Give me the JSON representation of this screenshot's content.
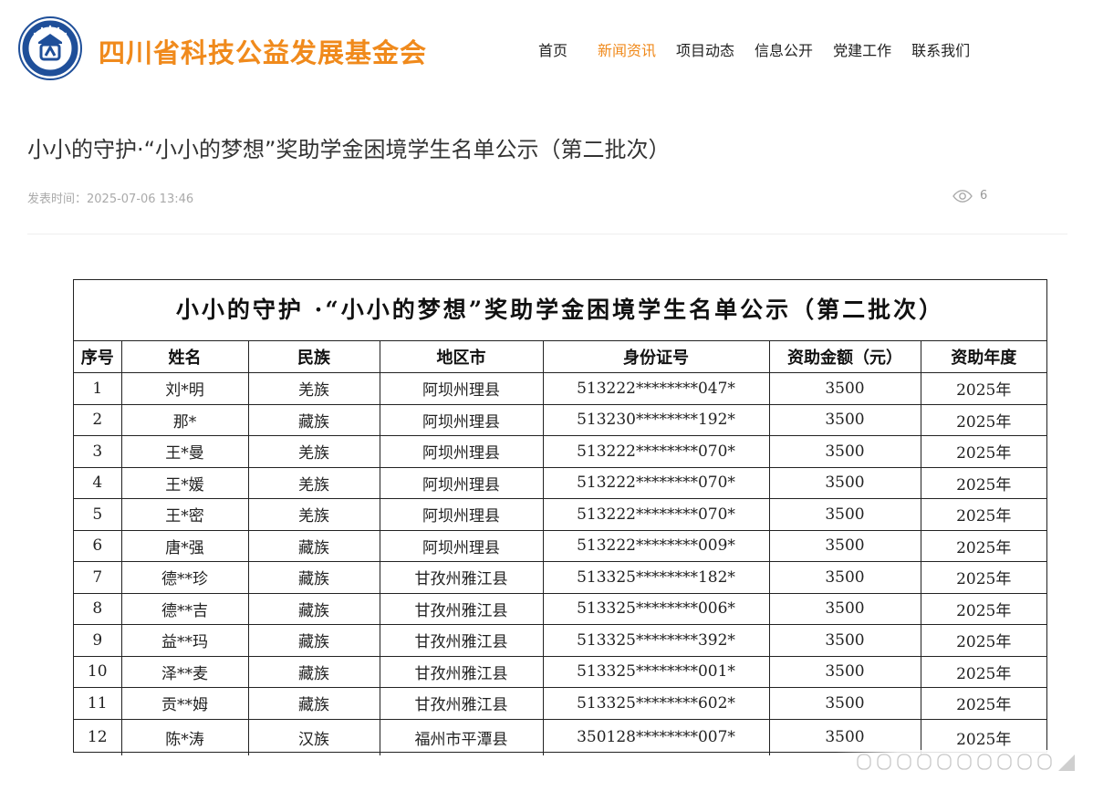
{
  "site": {
    "name": "四川省科技公益发展基金会",
    "logo_icon": "foundation-round-logo",
    "accent_color": "#f08a1c",
    "logo_color": "#1f4f99"
  },
  "nav": {
    "items": [
      {
        "label": "首页",
        "active": false
      },
      {
        "label": "新闻资讯",
        "active": true
      },
      {
        "label": "项目动态",
        "active": false
      },
      {
        "label": "信息公开",
        "active": false
      },
      {
        "label": "党建工作",
        "active": false
      },
      {
        "label": "联系我们",
        "active": false
      }
    ]
  },
  "article": {
    "title": "小小的守护·“小小的梦想”奖助学金困境学生名单公示（第二批次）",
    "published": "发表时间：2025-07-06 13:46",
    "views": "6",
    "views_icon": "eye-icon"
  },
  "notice": {
    "heading": "小小的守护 ·“小小的梦想”奖助学金困境学生名单公示（第二批次）",
    "columns": [
      "序号",
      "姓名",
      "民族",
      "地区市",
      "身份证号",
      "资助金额（元）",
      "资助年度"
    ],
    "rows": [
      [
        "1",
        "刘*明",
        "羌族",
        "阿坝州理县",
        "513222********047*",
        "3500",
        "2025年"
      ],
      [
        "2",
        "那*",
        "藏族",
        "阿坝州理县",
        "513230********192*",
        "3500",
        "2025年"
      ],
      [
        "3",
        "王*曼",
        "羌族",
        "阿坝州理县",
        "513222********070*",
        "3500",
        "2025年"
      ],
      [
        "4",
        "王*媛",
        "羌族",
        "阿坝州理县",
        "513222********070*",
        "3500",
        "2025年"
      ],
      [
        "5",
        "王*密",
        "羌族",
        "阿坝州理县",
        "513222********070*",
        "3500",
        "2025年"
      ],
      [
        "6",
        "唐*强",
        "藏族",
        "阿坝州理县",
        "513222********009*",
        "3500",
        "2025年"
      ],
      [
        "7",
        "德**珍",
        "藏族",
        "甘孜州雅江县",
        "513325********182*",
        "3500",
        "2025年"
      ],
      [
        "8",
        "德**吉",
        "藏族",
        "甘孜州雅江县",
        "513325********006*",
        "3500",
        "2025年"
      ],
      [
        "9",
        "益**玛",
        "藏族",
        "甘孜州雅江县",
        "513325********392*",
        "3500",
        "2025年"
      ],
      [
        "10",
        "泽**麦",
        "藏族",
        "甘孜州雅江县",
        "513325********001*",
        "3500",
        "2025年"
      ],
      [
        "11",
        "贡**姆",
        "藏族",
        "甘孜州雅江县",
        "513325********602*",
        "3500",
        "2025年"
      ],
      [
        "12",
        "陈*涛",
        "汉族",
        "福州市平潭县",
        "350128********007*",
        "3500",
        "2025年"
      ]
    ]
  }
}
